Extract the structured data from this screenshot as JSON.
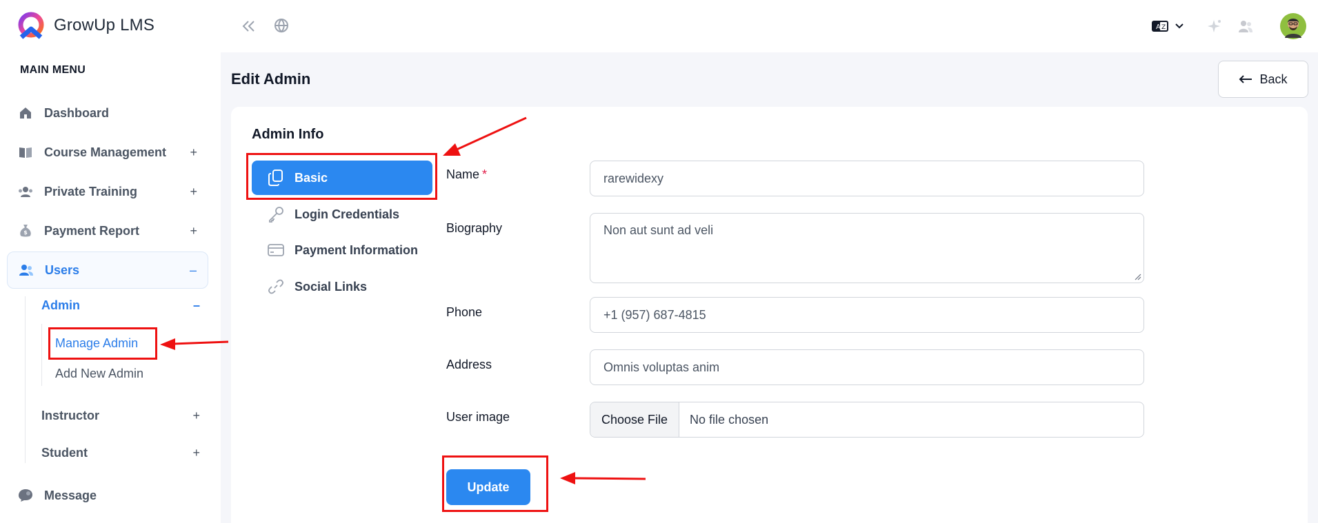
{
  "brand": {
    "name": "GrowUp LMS"
  },
  "sidebar": {
    "menu_title": "MAIN MENU",
    "items": [
      {
        "label": "Dashboard",
        "icon": "home-icon"
      },
      {
        "label": "Course Management",
        "icon": "book-icon",
        "toggle": "+"
      },
      {
        "label": "Private Training",
        "icon": "people-icon",
        "toggle": "+"
      },
      {
        "label": "Payment Report",
        "icon": "money-bag-icon",
        "toggle": "+"
      },
      {
        "label": "Users",
        "icon": "users-icon",
        "toggle": "–"
      }
    ],
    "users_sub": [
      {
        "label": "Admin",
        "toggle": "–"
      },
      {
        "label": "Instructor",
        "toggle": "+"
      },
      {
        "label": "Student",
        "toggle": "+"
      }
    ],
    "admin_sub": [
      {
        "label": "Manage Admin"
      },
      {
        "label": "Add New Admin"
      }
    ],
    "message": {
      "label": "Message",
      "icon": "message-icon"
    }
  },
  "header": {
    "language_icon": "translate-icon",
    "icons": [
      "collapse-icon",
      "globe-icon",
      "sparkle-icon",
      "user-group-icon",
      "avatar"
    ]
  },
  "page": {
    "title": "Edit Admin",
    "back_label": "Back",
    "card_title": "Admin Info"
  },
  "tabs": [
    {
      "label": "Basic",
      "icon": "copy-icon"
    },
    {
      "label": "Login Credentials",
      "icon": "key-icon"
    },
    {
      "label": "Payment Information",
      "icon": "card-icon"
    },
    {
      "label": "Social Links",
      "icon": "link-icon"
    }
  ],
  "form": {
    "name_label": "Name",
    "required_mark": "*",
    "name_value": "rarewidexy",
    "bio_label": "Biography",
    "bio_value": "Non aut sunt ad veli",
    "phone_label": "Phone",
    "phone_value": "+1 (957) 687-4815",
    "address_label": "Address",
    "address_value": "Omnis voluptas anim",
    "image_label": "User image",
    "file_button": "Choose File",
    "file_status": "No file chosen",
    "submit_label": "Update"
  },
  "colors": {
    "accent": "#2b88f0",
    "annotation": "#ee1111",
    "active_text": "#2b7de9"
  }
}
